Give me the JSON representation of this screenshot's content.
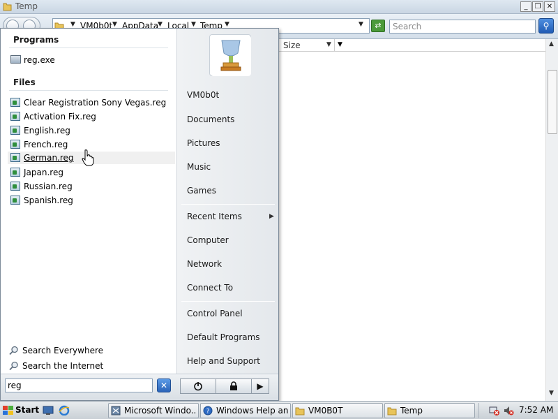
{
  "window": {
    "title": "Temp",
    "breadcrumbs": [
      "VM0b0t",
      "AppData",
      "Local",
      "Temp"
    ],
    "search_placeholder": "Search",
    "column_size": "Size",
    "btn_minimize": "_",
    "btn_maximize": "❐",
    "btn_close": "✕"
  },
  "start_menu": {
    "programs_title": "Programs",
    "programs": [
      {
        "label": "reg.exe",
        "icon": "exe-icon"
      }
    ],
    "files_title": "Files",
    "files": [
      {
        "label": "Clear Registration Sony Vegas.reg",
        "icon": "reg-file-icon"
      },
      {
        "label": "Activation Fix.reg",
        "icon": "reg-file-icon"
      },
      {
        "label": "English.reg",
        "icon": "reg-file-icon"
      },
      {
        "label": "French.reg",
        "icon": "reg-file-icon"
      },
      {
        "label": "German.reg",
        "icon": "reg-file-icon",
        "highlighted": true
      },
      {
        "label": "Japan.reg",
        "icon": "reg-file-icon"
      },
      {
        "label": "Russian.reg",
        "icon": "reg-file-icon"
      },
      {
        "label": "Spanish.reg",
        "icon": "reg-file-icon"
      }
    ],
    "search_everywhere": "Search Everywhere",
    "search_internet": "Search the Internet",
    "search_value": "reg",
    "right_items": [
      "VM0b0t",
      "Documents",
      "Pictures",
      "Music",
      "Games",
      "Recent Items",
      "Computer",
      "Network",
      "Connect To",
      "Control Panel",
      "Default Programs",
      "Help and Support"
    ]
  },
  "taskbar": {
    "start_label": "Start",
    "tasks": [
      {
        "label": "Microsoft Windo...",
        "icon": "app-icon"
      },
      {
        "label": "Windows Help an...",
        "icon": "help-icon"
      },
      {
        "label": "VM0B0T",
        "icon": "folder-icon"
      },
      {
        "label": "Temp",
        "icon": "folder-icon"
      }
    ],
    "clock": "7:52 AM"
  },
  "colors": {
    "selection_bg": "#f0f0f0",
    "accent_blue": "#2a63b8",
    "refresh_green": "#4b9a3a"
  }
}
